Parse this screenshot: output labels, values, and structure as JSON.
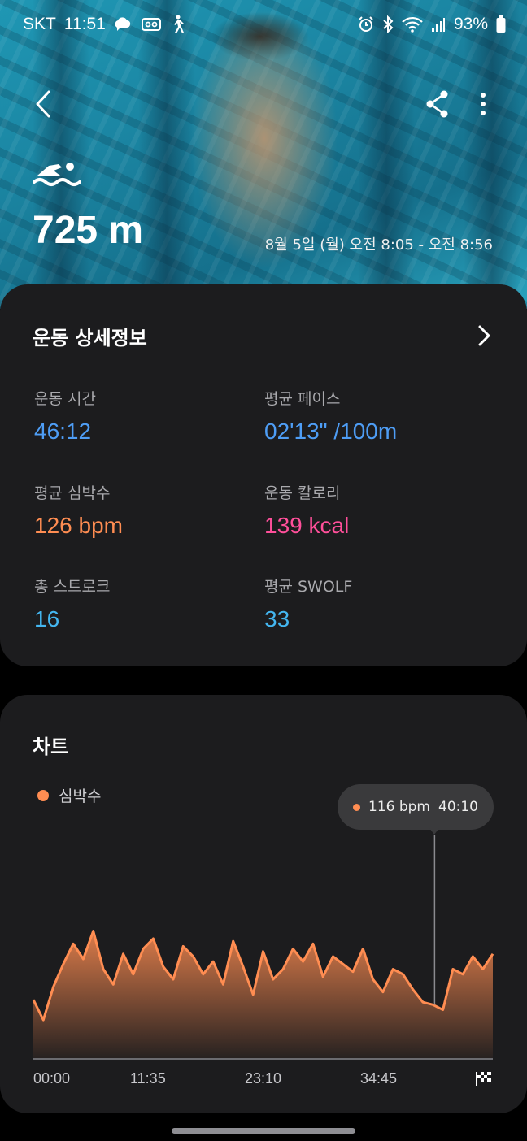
{
  "status_bar": {
    "carrier": "SKT",
    "time": "11:51",
    "battery": "93%",
    "icons_left": [
      "cloud-message-icon",
      "voicemail-icon",
      "walking-icon"
    ],
    "icons_right": [
      "alarm-icon",
      "bluetooth-icon",
      "wifi-icon",
      "signal-icon",
      "battery-icon"
    ]
  },
  "header": {
    "distance": "725 m",
    "date_range": "8월 5일 (월) 오전 8:05 - 오전 8:56"
  },
  "details": {
    "title": "운동 상세정보",
    "metrics": [
      {
        "label": "운동 시간",
        "value": "46:12",
        "color": "#4e9df5"
      },
      {
        "label": "평균 페이스",
        "value": "02'13\" /100m",
        "color": "#4e9df5"
      },
      {
        "label": "평균 심박수",
        "value": "126 bpm",
        "color": "#ff8d52"
      },
      {
        "label": "운동 칼로리",
        "value": "139 kcal",
        "color": "#ff4f9a"
      },
      {
        "label": "총 스트로크",
        "value": "16",
        "color": "#44b6f0"
      },
      {
        "label": "평균 SWOLF",
        "value": "33",
        "color": "#44b6f0"
      }
    ]
  },
  "chart_section": {
    "title": "차트",
    "legend": "심박수",
    "tooltip": {
      "value": "116 bpm",
      "time": "40:10"
    },
    "x_labels": [
      "00:00",
      "11:35",
      "23:10",
      "34:45"
    ]
  },
  "chart_data": {
    "type": "area",
    "series": [
      {
        "name": "심박수",
        "color": "#ff8d52"
      }
    ],
    "x_label_ticks": [
      "00:00",
      "11:35",
      "23:10",
      "34:45"
    ],
    "x_minutes": [
      0,
      1,
      2,
      3,
      4,
      5,
      6,
      7,
      8,
      9,
      10,
      11,
      12,
      13,
      14,
      15,
      16,
      17,
      18,
      19,
      20,
      21,
      22,
      23,
      24,
      25,
      26,
      27,
      28,
      29,
      30,
      31,
      32,
      33,
      34,
      35,
      36,
      37,
      38,
      39,
      40,
      41,
      42,
      43,
      44,
      45,
      46
    ],
    "bpm": [
      118,
      110,
      123,
      132,
      140,
      134,
      145,
      130,
      124,
      136,
      128,
      138,
      142,
      131,
      126,
      139,
      135,
      128,
      133,
      124,
      141,
      131,
      120,
      137,
      126,
      130,
      138,
      133,
      140,
      127,
      135,
      132,
      129,
      138,
      126,
      121,
      130,
      128,
      122,
      117,
      116,
      114,
      130,
      128,
      135,
      130,
      136
    ],
    "highlight": {
      "x_minutes": 40.17,
      "bpm": 116
    }
  }
}
